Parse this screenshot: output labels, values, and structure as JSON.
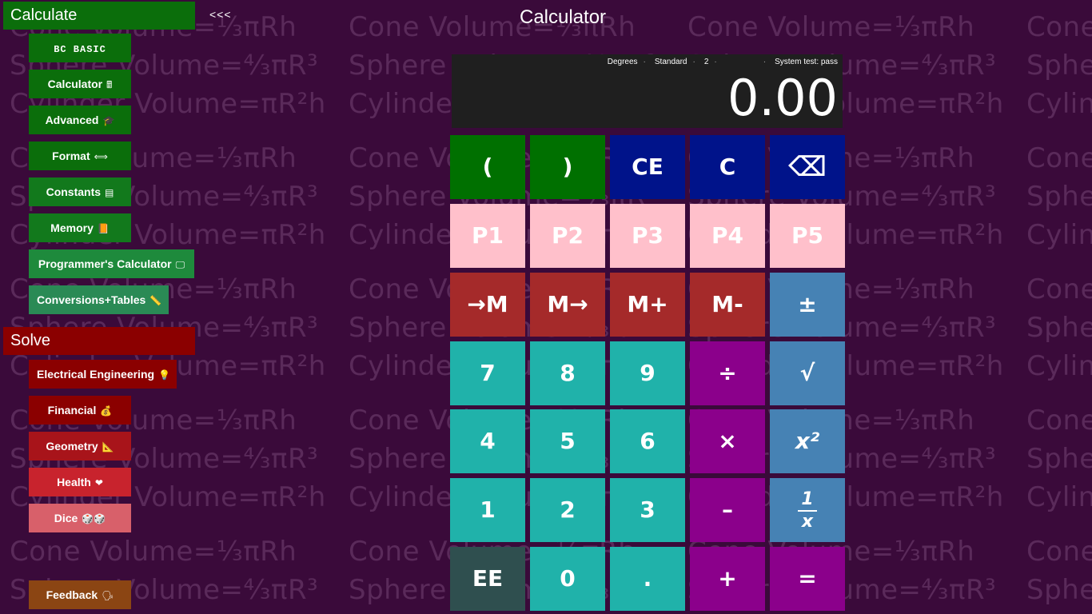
{
  "background": {
    "formulas": [
      "Cone Volume=⅓πRh",
      "Sphere Volume=⁴⁄₃πR³",
      "Cylinder Volume=πR²h"
    ]
  },
  "sidebar": {
    "calculate_header": "Calculate",
    "collapse_label": "<<<",
    "calculate_items": [
      {
        "label": "BC BASIC",
        "icon": "",
        "color": "#0b6e0b"
      },
      {
        "label": "Calculator",
        "icon": "🖩",
        "color": "#0b6e0b"
      },
      {
        "label": "Advanced",
        "icon": "🎓",
        "color": "#0b6e0b"
      },
      {
        "label": "Format",
        "icon": "⟺",
        "color": "#0b6e0b"
      },
      {
        "label": "Constants",
        "icon": "▤",
        "color": "#12791c"
      },
      {
        "label": "Memory",
        "icon": "📙",
        "color": "#12791c"
      },
      {
        "label": "Programmer's Calculator",
        "icon": "🖵",
        "color": "#1e8a3c"
      },
      {
        "label": "Conversions+Tables",
        "icon": "📏",
        "color": "#2a8a55"
      }
    ],
    "solve_header": "Solve",
    "solve_items": [
      {
        "label": "Electrical Engineering",
        "icon": "💡",
        "color": "#8b0000"
      },
      {
        "label": "Financial",
        "icon": "💰",
        "color": "#8b0000"
      },
      {
        "label": "Geometry",
        "icon": "📐",
        "color": "#a8141a"
      },
      {
        "label": "Health",
        "icon": "❤",
        "color": "#c8232d"
      },
      {
        "label": "Dice",
        "icon": "🎲🎲",
        "color": "#d8606a"
      }
    ],
    "feedback": {
      "label": "Feedback",
      "icon": "🗣",
      "color": "#8b4513"
    }
  },
  "title": "Calculator",
  "display": {
    "status": [
      "Degrees",
      "Standard",
      "2",
      "",
      "System test: pass"
    ],
    "value": "0.00"
  },
  "keypad": {
    "row1": [
      "(",
      ")",
      "CE",
      "C",
      "⌫"
    ],
    "row2": [
      "P1",
      "P2",
      "P3",
      "P4",
      "P5"
    ],
    "row3": [
      "→M",
      "M→",
      "M+",
      "M-",
      "±"
    ],
    "row4": [
      "7",
      "8",
      "9",
      "÷",
      "√"
    ],
    "row5": [
      "4",
      "5",
      "6",
      "×",
      "x²"
    ],
    "row6": [
      "1",
      "2",
      "3",
      "–",
      {
        "num": "1",
        "den": "x"
      }
    ],
    "row7": [
      "EE",
      "0",
      ".",
      "+",
      "="
    ]
  },
  "colors": {
    "background": "#3a0a3a",
    "parens": "#007000",
    "clear": "#00138a",
    "programmable": "#ffc0cb",
    "memory": "#a52a2a",
    "scientific": "#4682b4",
    "digits": "#20b2aa",
    "operators": "#8b008b",
    "ee": "#2f4f4f"
  }
}
